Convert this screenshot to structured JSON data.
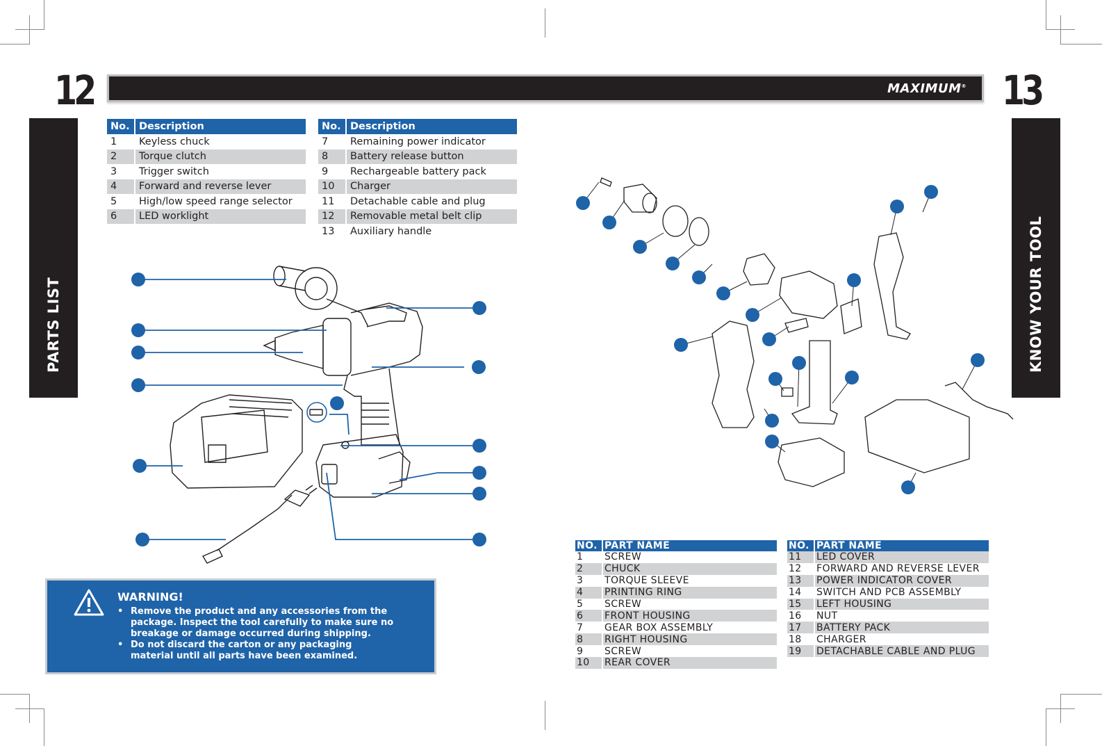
{
  "header": {
    "left_page_number": "12",
    "right_page_number": "13",
    "brand": "MAXIMUM",
    "brand_mark": "®"
  },
  "left_side_tab": "PARTS LIST",
  "right_side_tab": "KNOW YOUR TOOL",
  "parts_list": {
    "col_no": "No.",
    "col_desc": "Description",
    "table_a": [
      {
        "no": "1",
        "desc": "Keyless chuck"
      },
      {
        "no": "2",
        "desc": "Torque clutch"
      },
      {
        "no": "3",
        "desc": "Trigger switch"
      },
      {
        "no": "4",
        "desc": "Forward and reverse lever"
      },
      {
        "no": "5",
        "desc": "High/low speed range selector"
      },
      {
        "no": "6",
        "desc": "LED worklight"
      }
    ],
    "table_b": [
      {
        "no": "7",
        "desc": "Remaining power indicator"
      },
      {
        "no": "8",
        "desc": "Battery release button"
      },
      {
        "no": "9",
        "desc": "Rechargeable battery pack"
      },
      {
        "no": "10",
        "desc": "Charger"
      },
      {
        "no": "11",
        "desc": "Detachable cable and plug"
      },
      {
        "no": "12",
        "desc": "Removable metal belt clip"
      },
      {
        "no": "13",
        "desc": "Auxiliary handle"
      }
    ]
  },
  "warning": {
    "icon": "warning-triangle-icon",
    "title": "WARNING!",
    "items": [
      "Remove the product and any accessories from the package. Inspect the tool carefully to make sure no breakage or damage occurred during shipping.",
      "Do not discard the carton or any packaging material until all parts have been examined."
    ]
  },
  "know_your_tool": {
    "col_no": "NO.",
    "col_name": "PART NAME",
    "table_a": [
      {
        "no": "1",
        "name": "SCREW"
      },
      {
        "no": "2",
        "name": "CHUCK"
      },
      {
        "no": "3",
        "name": "TORQUE SLEEVE"
      },
      {
        "no": "4",
        "name": "PRINTING RING"
      },
      {
        "no": "5",
        "name": "SCREW"
      },
      {
        "no": "6",
        "name": "FRONT HOUSING"
      },
      {
        "no": "7",
        "name": "GEAR BOX ASSEMBLY"
      },
      {
        "no": "8",
        "name": "RIGHT HOUSING"
      },
      {
        "no": "9",
        "name": "SCREW"
      },
      {
        "no": "10",
        "name": "REAR COVER"
      }
    ],
    "table_b": [
      {
        "no": "11",
        "name": "LED COVER"
      },
      {
        "no": "12",
        "name": "FORWARD AND REVERSE LEVER"
      },
      {
        "no": "13",
        "name": "POWER INDICATOR COVER"
      },
      {
        "no": "14",
        "name": "SWITCH AND PCB ASSEMBLY"
      },
      {
        "no": "15",
        "name": "LEFT HOUSING"
      },
      {
        "no": "16",
        "name": "NUT"
      },
      {
        "no": "17",
        "name": "BATTERY PACK"
      },
      {
        "no": "18",
        "name": "CHARGER"
      },
      {
        "no": "19",
        "name": "DETACHABLE CABLE AND PLUG"
      }
    ]
  },
  "colors": {
    "accent_blue": "#1f63a8",
    "dark": "#231f20",
    "row_shade": "#d1d2d4"
  }
}
